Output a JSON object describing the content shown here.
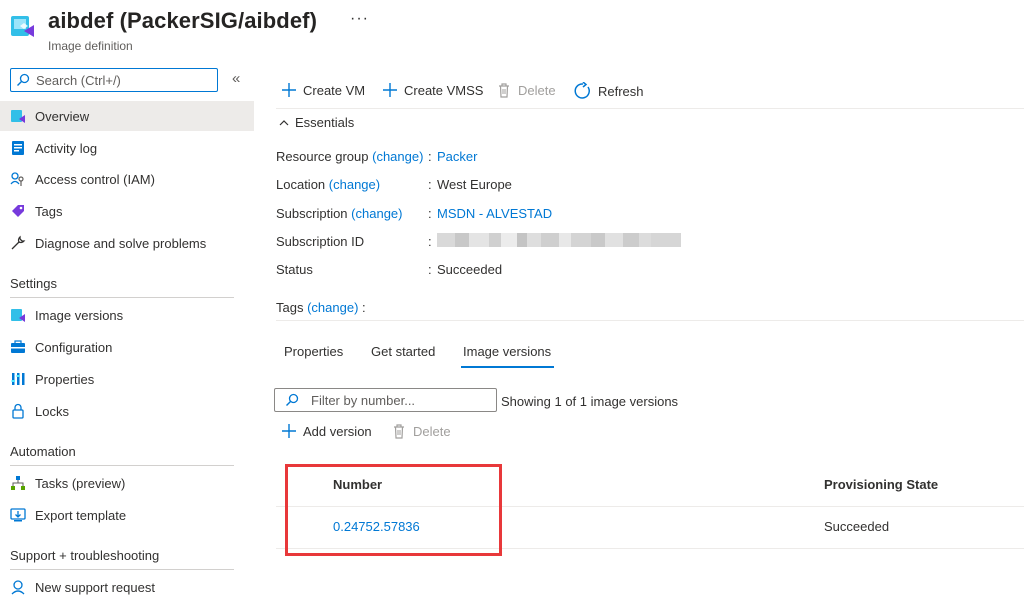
{
  "header": {
    "title": "aibdef (PackerSIG/aibdef)",
    "subtitle": "Image definition",
    "more_label": "···"
  },
  "sidebar": {
    "search_placeholder": "Search (Ctrl+/)",
    "collapse_label": "«",
    "items": [
      {
        "label": "Overview",
        "icon": "overview-icon"
      },
      {
        "label": "Activity log",
        "icon": "activity-log-icon"
      },
      {
        "label": "Access control (IAM)",
        "icon": "iam-icon"
      },
      {
        "label": "Tags",
        "icon": "tag-icon"
      },
      {
        "label": "Diagnose and solve problems",
        "icon": "wrench-icon"
      }
    ],
    "sections": [
      {
        "title": "Settings",
        "items": [
          {
            "label": "Image versions",
            "icon": "image-versions-icon"
          },
          {
            "label": "Configuration",
            "icon": "configuration-icon"
          },
          {
            "label": "Properties",
            "icon": "properties-icon"
          },
          {
            "label": "Locks",
            "icon": "lock-icon"
          }
        ]
      },
      {
        "title": "Automation",
        "items": [
          {
            "label": "Tasks (preview)",
            "icon": "tasks-icon"
          },
          {
            "label": "Export template",
            "icon": "export-template-icon"
          }
        ]
      },
      {
        "title": "Support + troubleshooting",
        "items": [
          {
            "label": "New support request",
            "icon": "support-icon"
          }
        ]
      }
    ]
  },
  "toolbar": {
    "create_vm": "Create VM",
    "create_vmss": "Create VMSS",
    "delete": "Delete",
    "refresh": "Refresh"
  },
  "essentials": {
    "title": "Essentials",
    "resource_group_label": "Resource group",
    "resource_group_value": "Packer",
    "location_label": "Location",
    "location_value": "West Europe",
    "subscription_label": "Subscription",
    "subscription_value": "MSDN - ALVESTAD",
    "subscription_id_label": "Subscription ID",
    "status_label": "Status",
    "status_value": "Succeeded",
    "tags_label": "Tags",
    "change_label": "(change)",
    "colon": ":"
  },
  "tabs": [
    {
      "label": "Properties",
      "active": false
    },
    {
      "label": "Get started",
      "active": false
    },
    {
      "label": "Image versions",
      "active": true
    }
  ],
  "versions": {
    "filter_placeholder": "Filter by number...",
    "showing_text": "Showing 1 of 1 image versions",
    "add_version": "Add version",
    "delete": "Delete",
    "columns": [
      "Number",
      "Provisioning State"
    ],
    "rows": [
      {
        "number": "0.24752.57836",
        "state": "Succeeded"
      }
    ]
  },
  "colors": {
    "accent": "#0078d4",
    "highlight_box": "#e8383a",
    "selected_nav": "#edebe9"
  }
}
